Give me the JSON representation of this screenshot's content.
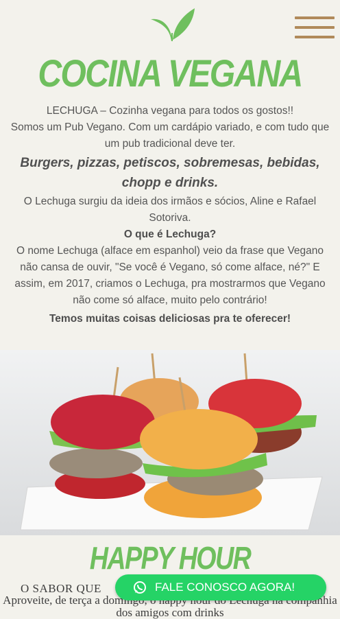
{
  "header": {
    "logo_icon": "leaf-sprout-icon",
    "menu_icon": "hamburger-menu-icon",
    "brand_color": "#6fbf5e",
    "menu_color": "#b08a5a"
  },
  "title": "COCINA VEGANA",
  "intro": {
    "line1": "LECHUGA – Cozinha vegana para todos os gostos!!",
    "line2": "Somos um Pub Vegano. Com um cardápio variado, e com tudo que um pub tradicional deve ter.",
    "highlight": "Burgers, pizzas, petiscos, sobremesas, bebidas, chopp e drinks.",
    "origin": "O Lechuga surgiu da ideia dos irmãos e sócios, Aline e Rafael Sotoriva.",
    "question": "O que é Lechuga?",
    "answer": "O nome Lechuga (alface em espanhol) veio da frase que Vegano não cansa de ouvir, \"Se você é Vegano, só come alface, né?\" E assim, em 2017, criamos o Lechuga, pra mostrarmos que Vegano não come só alface, muito pelo contrário!",
    "offer": "Temos muitas coisas deliciosas pra te oferecer!"
  },
  "happy_hour": {
    "title": "HAPPY HOUR",
    "subtitle": "O SABOR QUE",
    "text": "Aproveite, de terça a domingo, o happy hour do Lechuga na companhia dos amigos com drinks"
  },
  "cta": {
    "label": "FALE CONOSCO AGORA!",
    "icon": "whatsapp-icon",
    "color": "#25d366"
  }
}
